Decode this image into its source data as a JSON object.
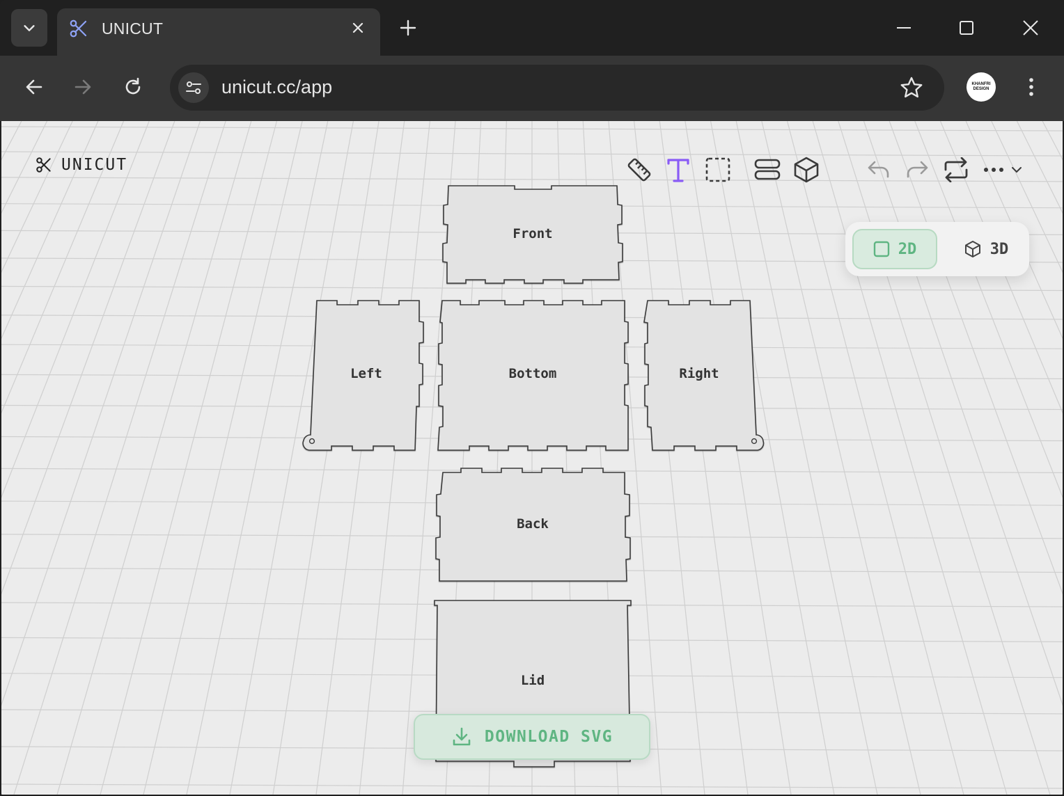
{
  "browser": {
    "tab_title": "UNICUT",
    "url": "unicut.cc/app",
    "profile_text": [
      "KHANFRI",
      "DESIGN"
    ]
  },
  "app": {
    "logo_text": "UNICUT",
    "view_toggle": {
      "option_2d": "2D",
      "option_3d": "3D",
      "selected": "2D"
    },
    "panels": [
      "Front",
      "Left",
      "Bottom",
      "Right",
      "Back",
      "Lid"
    ],
    "download_label": "DOWNLOAD SVG",
    "accent_color": "#5fb582",
    "text_tool_color": "#8a5cf6"
  }
}
